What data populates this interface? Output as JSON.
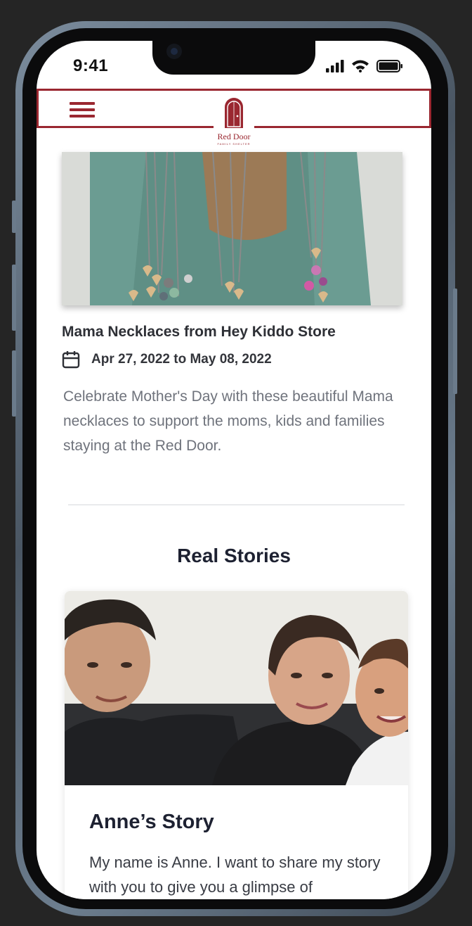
{
  "status_bar": {
    "time": "9:41",
    "icons": [
      "cellular-signal-icon",
      "wifi-icon",
      "battery-icon"
    ]
  },
  "header": {
    "menu_icon": "hamburger-menu-icon",
    "logo": {
      "icon": "red-door-icon",
      "text": "Red Door",
      "subtext": "FAMILY SHELTER"
    }
  },
  "event": {
    "image_subject": "necklaces",
    "title": "Mama Necklaces from Hey Kiddo Store",
    "date_icon": "calendar-icon",
    "date_range": "Apr 27, 2022 to May 08, 2022",
    "description": "Celebrate Mother's Day with these beautiful Mama necklaces to support the moms, kids and families staying at the Red Door."
  },
  "stories": {
    "section_title": "Real Stories",
    "items": [
      {
        "title": "Anne’s Story",
        "excerpt": "My name is Anne. I want to share my story with you to give you a glimpse of"
      }
    ]
  },
  "colors": {
    "brand_red": "#9a2730",
    "heading": "#1d2131",
    "body_text": "#6f737c"
  }
}
